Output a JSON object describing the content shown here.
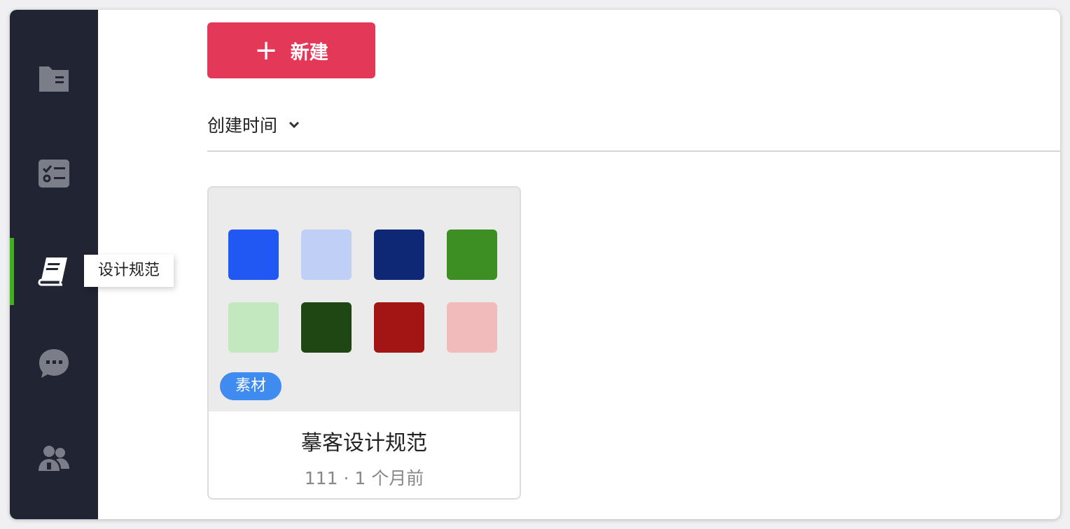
{
  "sidebar": {
    "items": [
      {
        "name": "folder",
        "icon": "folder-icon",
        "active": false
      },
      {
        "name": "tasks",
        "icon": "checklist-icon",
        "active": false
      },
      {
        "name": "design-spec",
        "icon": "book-icon",
        "active": true
      },
      {
        "name": "chat",
        "icon": "chat-bubble-icon",
        "active": false
      },
      {
        "name": "team",
        "icon": "users-icon",
        "active": false
      }
    ],
    "tooltip": "设计规范",
    "active_color": "#3fb11c",
    "icon_color": "#7b7e89"
  },
  "toolbar": {
    "new_label": "新建",
    "new_color": "#e43858"
  },
  "sort": {
    "label": "创建时间"
  },
  "card": {
    "title": "摹客设计规范",
    "meta": "111 · 1 个月前",
    "tag": "素材",
    "swatches": [
      "#2158f4",
      "#bfcff6",
      "#0f2875",
      "#3d8f24",
      "#c3e8bf",
      "#1f4713",
      "#a31515",
      "#f1bbbb"
    ]
  }
}
